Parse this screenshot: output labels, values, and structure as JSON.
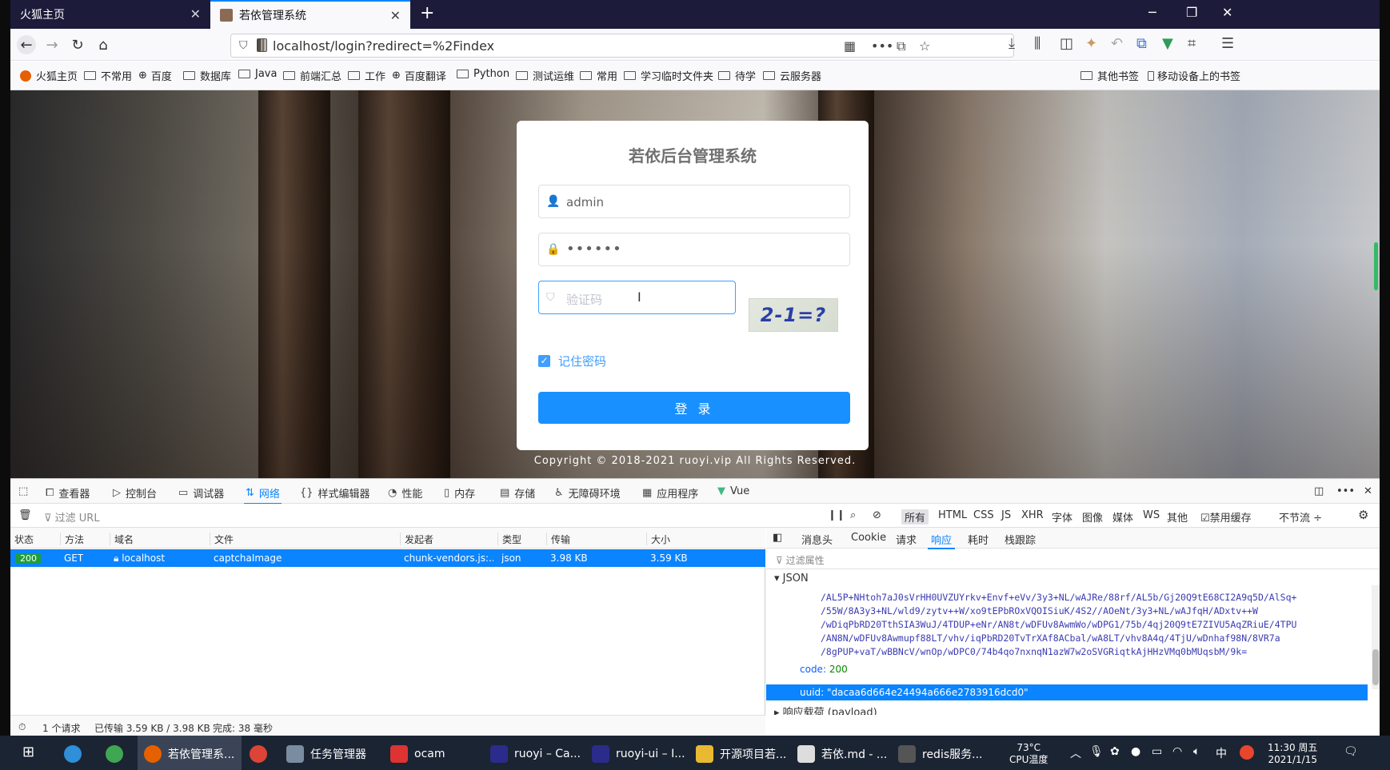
{
  "browser": {
    "tabs": [
      {
        "title": "火狐主页"
      },
      {
        "title": "若依管理系统"
      }
    ],
    "url": "localhost/login?redirect=%2Findex",
    "bookmarks": [
      "火狐主页",
      "不常用",
      "百度",
      "数据库",
      "Java",
      "前端汇总",
      "工作",
      "百度翻译",
      "Python",
      "测试运维",
      "常用",
      "学习临时文件夹",
      "待学",
      "云服务器"
    ],
    "bookmarks_right": [
      "其他书签",
      "移动设备上的书签"
    ]
  },
  "login": {
    "title": "若依后台管理系统",
    "username": "admin",
    "password": "••••••",
    "captcha_placeholder": "验证码",
    "captcha_image_text": "2-1=?",
    "remember_label": "记住密码",
    "login_button": "登 录",
    "copyright": "Copyright © 2018-2021 ruoyi.vip All Rights Reserved."
  },
  "devtools": {
    "tabs": [
      "查看器",
      "控制台",
      "调试器",
      "网络",
      "样式编辑器",
      "性能",
      "内存",
      "存储",
      "无障碍环境",
      "应用程序",
      "Vue"
    ],
    "filter_placeholder": "过滤 URL",
    "type_filters": [
      "所有",
      "HTML",
      "CSS",
      "JS",
      "XHR",
      "字体",
      "图像",
      "媒体",
      "WS",
      "其他"
    ],
    "disable_cache": "禁用缓存",
    "throttle": "不节流 ÷",
    "columns": [
      "状态",
      "方法",
      "域名",
      "文件",
      "发起者",
      "类型",
      "传输",
      "大小"
    ],
    "request": {
      "status": "200",
      "method": "GET",
      "domain": "localhost",
      "file": "captchaImage",
      "initiator": "chunk-vendors.js:...",
      "type": "json",
      "transferred": "3.98 KB",
      "size": "3.59 KB"
    },
    "panel_tabs": [
      "消息头",
      "Cookie",
      "请求",
      "响应",
      "耗时",
      "栈跟踪"
    ],
    "panel_filter": "过滤属性",
    "json_label": "JSON",
    "json_lines": [
      "/AL5P+NHtoh7aJ0sVrHH0UVZUYrkv+Envf+eVv/3y3+NL/wAJRe/88rf/AL5b/Gj20Q9tE68CI2A9q5D/AlSq+",
      "/55W/8A3y3+NL/wld9/zytv++W/xo9tEPbROxVQOISiuK/4S2//AOeNt/3y3+NL/wAJfqH/ADxtv++W",
      "/wDiqPbRD20TthSIA3WuJ/4TDUP+eNr/AN8t/wDFUv8AwmWo/wDPG1/75b/4qj20Q9tE7ZIVU5AqZRiuE/4TPU",
      "/AN8N/wDFUv8Awmupf88LT/vhv/iqPbRD20TvTrXAf8ACbal/wA8LT/vhv8A4q/4TjU/wDnhaf98N/8VR7a",
      "/8gPUP+vaT/wBBNcV/wnOp/wDPC0/74b4qo7nxnqN1azW7w2oSVGRiqtkAjHHzVMq0bMUqsbM/9k="
    ],
    "code_key": "code:",
    "code_val": "200",
    "uuid_key": "uuid:",
    "uuid_val": "\"dacaa6d664e24494a666e2783916dcd0\"",
    "payload_label": "响应载荷 (payload)",
    "status_bar": {
      "requests": "1 个请求",
      "transferred": "已传输 3.59 KB / 3.98 KB",
      "finished": "完成: 38 毫秒"
    }
  },
  "taskbar": {
    "items": [
      "若依管理系...",
      "任务管理器",
      "ocam",
      "ruoyi – Ca...",
      "ruoyi-ui – I...",
      "开源项目若...",
      "若依.md - ...",
      "redis服务..."
    ],
    "temp": "73°C",
    "temp_label": "CPU温度",
    "ime": "中",
    "time": "11:30 周五",
    "date": "2021/1/15"
  }
}
